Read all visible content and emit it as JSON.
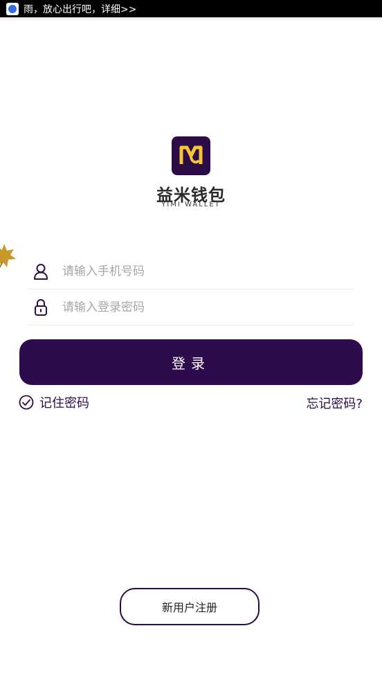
{
  "status_bar": {
    "notification_text": "雨，放心出行吧，详细>>",
    "app_icon": "baidu-paw-icon"
  },
  "brand": {
    "logo_icon": "yimi-m-logo-icon",
    "name_cn": "益米钱包",
    "name_en": "YIMI WALLET",
    "logo_bg": "#2b0c47",
    "logo_fg": "#f5c533"
  },
  "decoration": {
    "leaf_icon": "maple-leaf-icon"
  },
  "form": {
    "phone": {
      "icon": "user-icon",
      "value": "",
      "placeholder": "请输入手机号码"
    },
    "password": {
      "icon": "lock-icon",
      "value": "",
      "placeholder": "请输入登录密码"
    }
  },
  "actions": {
    "login_label": "登录",
    "remember_label": "记住密码",
    "remember_icon": "check-circle-icon",
    "forgot_label": "忘记密码?",
    "register_label": "新用户注册"
  },
  "colors": {
    "primary": "#2d0b4d",
    "text_dark": "#2b0c47",
    "placeholder": "#a6a6a6",
    "divider": "#eeeeee"
  }
}
